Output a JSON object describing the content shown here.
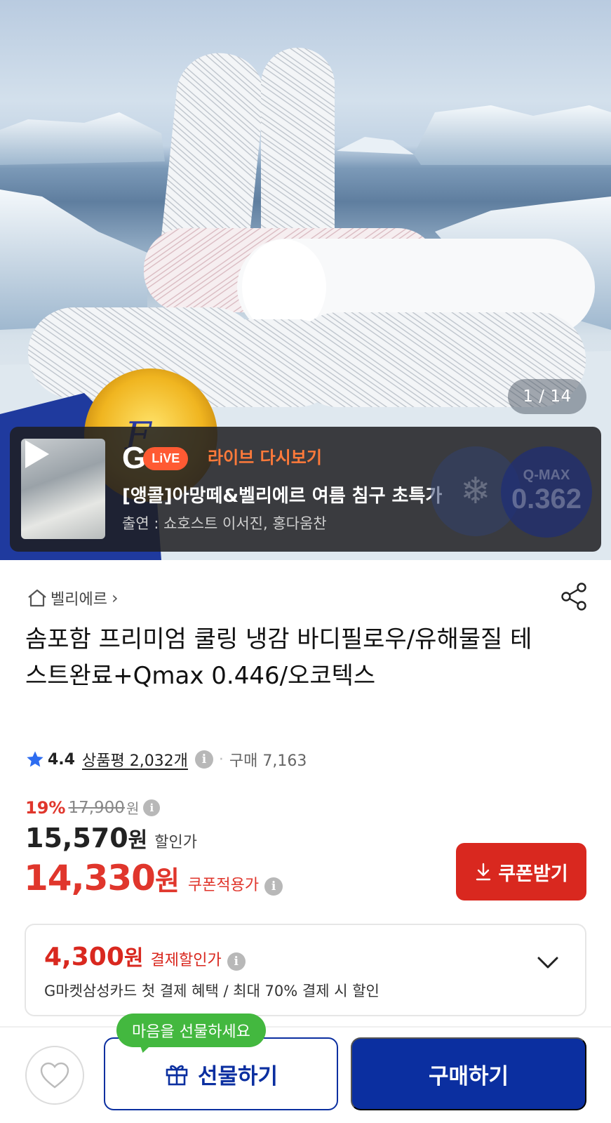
{
  "gallery": {
    "counter": "1 / 14",
    "icons": [
      "pillow-product-image",
      "play-icon"
    ]
  },
  "live": {
    "logo_letter": "G",
    "logo_pill": "LiVE",
    "replay_label": "라이브 다시보기",
    "title": "[앵콜]아망떼&벨리에르 여름 침구 초특가",
    "cast": "출연 : 쇼호스트 이서진, 홍다움찬",
    "badge_top": "Q-MAX",
    "badge_num": "0.362",
    "colors": {
      "live_orange": "#ff5a33",
      "replay_text": "#ff7a3a"
    }
  },
  "seller": {
    "name": "벨리에르",
    "chevron": "›"
  },
  "product": {
    "title": "솜포함 프리미엄 쿨링 냉감 바디필로우/유해물질 테스트완료+Qmax 0.446/오코텍스"
  },
  "rating": {
    "score": "4.4",
    "reviews": "상품평 2,032개",
    "info": "i",
    "purchases": "구매 7,163"
  },
  "price": {
    "discount_pct": "19%",
    "original": "17,900",
    "original_unit": "원",
    "sale_amount": "15,570",
    "sale_unit": "원",
    "sale_label": "할인가",
    "coupon_amount": "14,330",
    "coupon_unit": "원",
    "coupon_label": "쿠폰적용가",
    "coupon_button": "쿠폰받기",
    "colors": {
      "accent_red": "#d9281f"
    }
  },
  "card_offer": {
    "amount": "4,300",
    "unit": "원",
    "label": "결제할인가",
    "description": "G마켓삼성카드 첫 결제 혜택 / 최대 70% 결제 시 할인"
  },
  "bottom_bar": {
    "tooltip": "마음을 선물하세요",
    "gift_label": "선물하기",
    "buy_label": "구매하기",
    "colors": {
      "primary_blue": "#0b2fa0",
      "tooltip_green": "#43b83f"
    }
  }
}
